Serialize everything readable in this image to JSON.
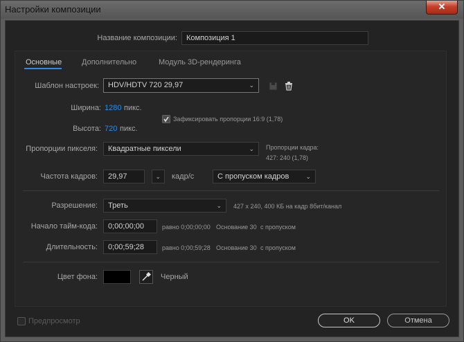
{
  "window": {
    "title": "Настройки композиции",
    "close_label": "✕"
  },
  "comp_name": {
    "label": "Название композиции:",
    "value": "Композиция 1"
  },
  "tabs": [
    {
      "label": "Основные",
      "active": true
    },
    {
      "label": "Дополнительно",
      "active": false
    },
    {
      "label": "Модуль 3D-рендеринга",
      "active": false
    }
  ],
  "preset": {
    "label": "Шаблон настроек:",
    "value": "HDV/HDTV 720 29,97"
  },
  "width": {
    "label": "Ширина:",
    "value": "1280",
    "unit": "пикс."
  },
  "height": {
    "label": "Высота:",
    "value": "720",
    "unit": "пикс."
  },
  "lock_aspect": {
    "label": "Зафиксировать пропорции 16:9 (1,78)",
    "checked": true
  },
  "pixel_aspect": {
    "label": "Пропорции пикселя:",
    "value": "Квадратные пиксели",
    "frame_aspect_label": "Пропорции кадра:",
    "frame_aspect_value": "427: 240 (1,78)"
  },
  "frame_rate": {
    "label": "Частота кадров:",
    "value": "29,97",
    "unit": "кадр/с",
    "drop_frame": "С пропуском кадров"
  },
  "resolution": {
    "label": "Разрешение:",
    "value": "Треть",
    "info": "427 x 240, 400 КБ на кадр 8бит/канал"
  },
  "start_timecode": {
    "label": "Начало тайм-кода:",
    "value": "0;00;00;00",
    "equals": "равно 0;00;00;00",
    "base": "Основание 30",
    "mode": "с пропуском"
  },
  "duration": {
    "label": "Длительность:",
    "value": "0;00;59;28",
    "equals": "равно 0;00;59;28",
    "base": "Основание 30",
    "mode": "с пропуском"
  },
  "background": {
    "label": "Цвет фона:",
    "color_name": "Черный",
    "color": "#000000"
  },
  "footer": {
    "preview_label": "Предпросмотр",
    "ok_label": "OK",
    "cancel_label": "Отмена"
  },
  "colors": {
    "accent": "#2d8ceb",
    "close": "#c4402a"
  }
}
